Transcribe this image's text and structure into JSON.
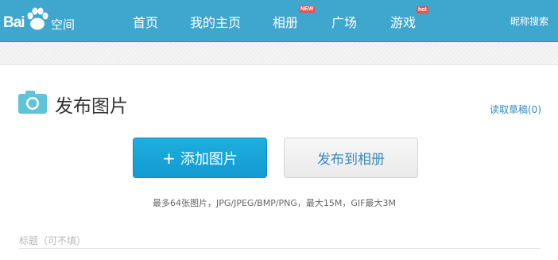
{
  "header": {
    "logo_left": "Bai",
    "logo_right": "空间",
    "nav": [
      {
        "label": "首页"
      },
      {
        "label": "我的主页"
      },
      {
        "label": "相册",
        "badge": "NEW"
      },
      {
        "label": "广场"
      },
      {
        "label": "游戏",
        "badge": "hot"
      }
    ],
    "search_label": "昵称搜索"
  },
  "main": {
    "page_title": "发布图片",
    "drafts_link": "读取草稿(0)",
    "add_button_plus": "+",
    "add_button_label": "添加图片",
    "publish_button_label": "发布到相册",
    "upload_hint": "最多64张图片，JPG/JPEG/BMP/PNG，最大15M，GIF最大3M",
    "title_label": "标题（可不填）"
  },
  "colors": {
    "header_bg": "#3fa6cd",
    "primary_button": "#1eaee0",
    "link": "#2d8bbf",
    "badge": "#e8534b"
  },
  "icons": {
    "logo": "paw-icon",
    "page_title": "camera-icon"
  }
}
